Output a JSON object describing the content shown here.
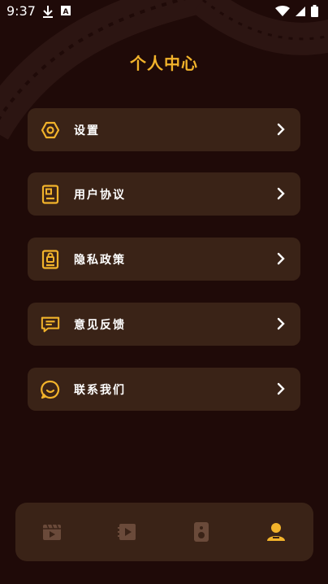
{
  "status_bar": {
    "time": "9:37",
    "icons": [
      "download-icon",
      "a-notification-icon",
      "wifi-icon",
      "cell-signal-icon",
      "battery-icon"
    ]
  },
  "header": {
    "title": "个人中心"
  },
  "menu": {
    "items": [
      {
        "label": "设置",
        "icon": "settings-icon"
      },
      {
        "label": "用户协议",
        "icon": "user-agreement-icon"
      },
      {
        "label": "隐私政策",
        "icon": "privacy-policy-icon"
      },
      {
        "label": "意见反馈",
        "icon": "feedback-icon"
      },
      {
        "label": "联系我们",
        "icon": "contact-us-icon"
      }
    ]
  },
  "tab_bar": {
    "tabs": [
      {
        "icon": "clapperboard-icon",
        "active": false
      },
      {
        "icon": "video-play-icon",
        "active": false
      },
      {
        "icon": "speaker-icon",
        "active": false
      },
      {
        "icon": "user-icon",
        "active": true
      }
    ]
  },
  "colors": {
    "background": "#1f0a08",
    "card": "#3a2317",
    "accent": "#f2b32b",
    "inactive_icon": "#6a4a3a"
  }
}
